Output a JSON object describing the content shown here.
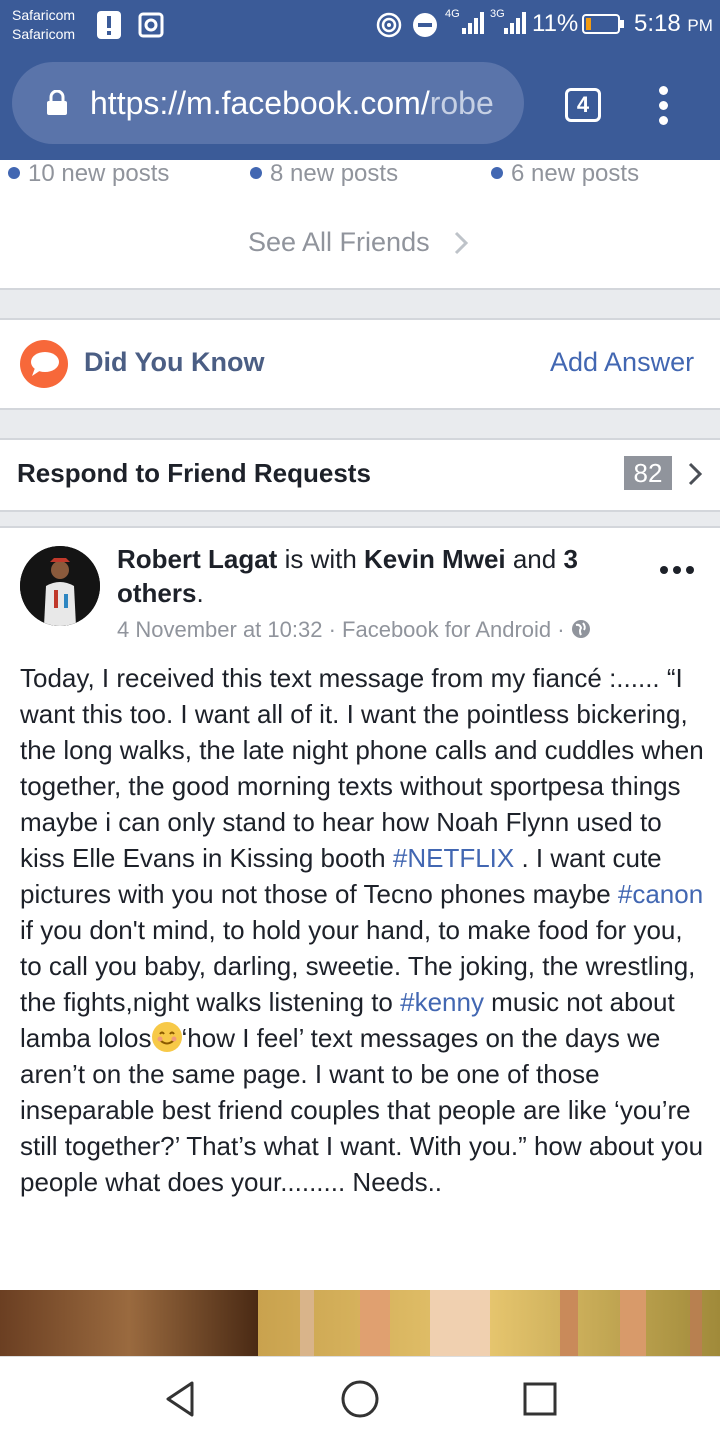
{
  "status_bar": {
    "carrier_1": "Safaricom",
    "carrier_2": "Safaricom",
    "network_1": "4G",
    "network_2": "3G",
    "battery": "11%",
    "time": "5:18",
    "ampm": "PM"
  },
  "browser": {
    "url_host": "https://m.facebook.com/",
    "url_rest": "robe",
    "tab_count": "4"
  },
  "friends_posts": [
    {
      "label": "10 new posts"
    },
    {
      "label": "8 new posts"
    },
    {
      "label": "6 new posts"
    }
  ],
  "see_all_friends": "See All Friends",
  "did_you_know": {
    "title": "Did You Know",
    "action": "Add Answer"
  },
  "friend_requests": {
    "title": "Respond to Friend Requests",
    "count": "82"
  },
  "post": {
    "author": "Robert Lagat",
    "with_text": " is with ",
    "tagged": "Kevin Mwei",
    "and_text": " and ",
    "others_count": "3",
    "others_word": "others",
    "period": ".",
    "date": "4 November at 10:32",
    "separator": " · ",
    "source": "Facebook for Android",
    "separator_2": " · ",
    "body_1": "Today, I received this text message from my fiancé :...... “I want this too. I want all of it. I want the pointless bickering, the long walks, the late night phone calls and cuddles when together, the good morning texts without sportpesa things maybe i can only stand to hear how Noah Flynn used to kiss Elle Evans in Kissing booth ",
    "tag_1": "#NETFLIX",
    "body_2": " . I want cute pictures with you not those of Tecno phones maybe ",
    "tag_2": "#canon",
    "body_3": " if you don't mind, to hold your hand, to make food for you, to call you baby, darling, sweetie. The joking, the wrestling, the fights,night walks listening to ",
    "tag_3": "#kenny",
    "body_4": " music not about lamba lolos",
    "body_5": "‘how I feel’ text messages on the days we aren’t on the same page. I want to be one of those inseparable best friend couples that people are like ‘you’re still together?’ That’s what I want. With you.” how about you people what does your......... Needs.."
  },
  "colors": {
    "facebook_blue": "#3b5b98",
    "link_blue": "#4267b2",
    "grey_text": "#90949c",
    "dyk_orange": "#f7683a"
  },
  "icons": [
    "lock-icon",
    "tabs-icon",
    "overflow-menu-icon",
    "chevron-right-icon",
    "speech-bubble-icon",
    "globe-icon",
    "back-icon",
    "home-icon",
    "recents-icon"
  ]
}
